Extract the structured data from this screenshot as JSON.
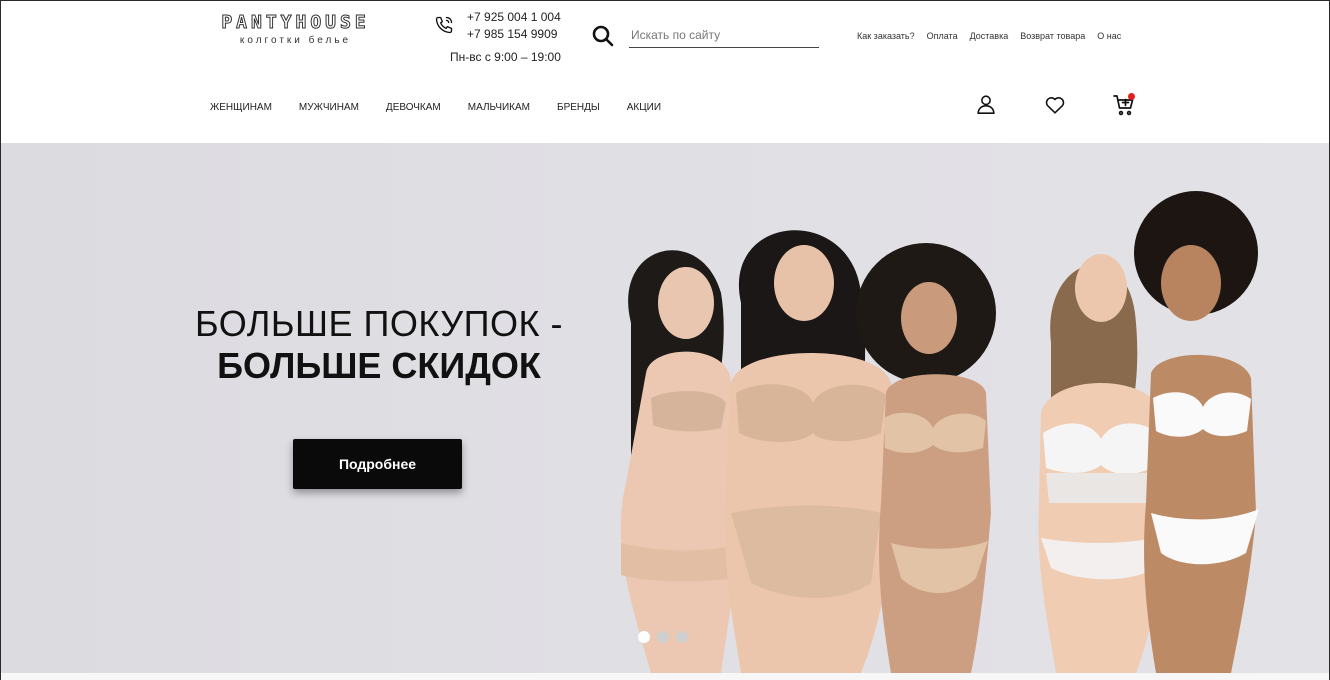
{
  "header": {
    "logo": {
      "main": "PANTYHOUSE",
      "sub": "колготки белье"
    },
    "contacts": {
      "phone1": "+7 925 004 1 004",
      "phone2": "+7 985 154 9909",
      "hours": "Пн-вс с 9:00 – 19:00"
    },
    "search": {
      "placeholder": "Искать по сайту"
    },
    "top_links": [
      "Как заказать?",
      "Оплата",
      "Доставка",
      "Возврат товара",
      "О нас"
    ],
    "categories": [
      "ЖЕНЩИНАМ",
      "МУЖЧИНАМ",
      "ДЕВОЧКАМ",
      "МАЛЬЧИКАМ",
      "БРЕНДЫ",
      "АКЦИИ"
    ],
    "icons": {
      "phone": "phone-icon",
      "search": "search-icon",
      "user": "user-icon",
      "favorites": "heart-icon",
      "cart": "cart-icon"
    },
    "cart_badge_color": "#e02020"
  },
  "hero": {
    "title_line1": "БОЛЬШЕ ПОКУПОК -",
    "title_line2": "БОЛЬШЕ СКИДОК",
    "button_label": "Подробнее",
    "slides_count": 3,
    "active_slide": 1
  },
  "colors": {
    "hero_bg": "#e0dfe4",
    "button_bg": "#0a0a0a",
    "text": "#111111"
  }
}
